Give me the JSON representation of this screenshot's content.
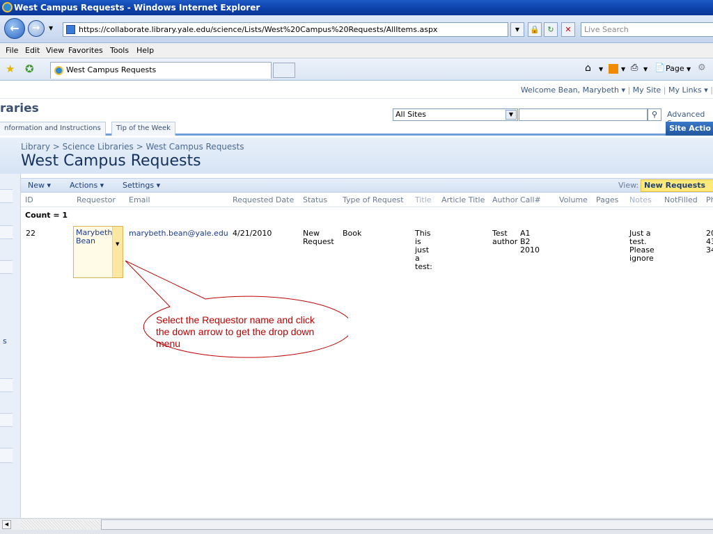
{
  "window": {
    "title": "West Campus Requests - Windows Internet Explorer"
  },
  "browser": {
    "url": "https://collaborate.library.yale.edu/science/Lists/West%20Campus%20Requests/AllItems.aspx",
    "search_placeholder": "Live Search",
    "menu": [
      "File",
      "Edit",
      "View",
      "Favorites",
      "Tools",
      "Help"
    ],
    "tab_title": "West Campus Requests",
    "page_tool": "Page"
  },
  "sharepoint": {
    "welcome": "Welcome Bean, Marybeth ▾",
    "my_site": "My Site",
    "my_links": "My Links ▾",
    "brand": "raries",
    "scope": "All Sites",
    "advanced_search": "Advanced Se",
    "nav_tabs": [
      "nformation and Instructions",
      "Tip of the Week"
    ],
    "site_actions": "Site Actio",
    "breadcrumb": "Library > Science Libraries > West Campus Requests",
    "page_title": "West Campus Requests"
  },
  "toolbar": {
    "new": "New ▾",
    "actions": "Actions ▾",
    "settings": "Settings ▾",
    "view_label": "View:",
    "view_value": "New Requests"
  },
  "list": {
    "columns": [
      "ID",
      "Requestor",
      "Email",
      "Requested Date",
      "Status",
      "Type of Request",
      "Title",
      "Article Title",
      "Author",
      "Call#",
      "Volume",
      "Pages",
      "Notes",
      "NotFilled",
      "Ph"
    ],
    "count": "Count = 1",
    "row": {
      "id": "22",
      "requestor": "Marybeth Bean",
      "email": "marybeth.bean@yale.edu",
      "date": "4/21/2010",
      "status": "New Request",
      "type": "Book",
      "title": "This is just a test:",
      "author": "Test author",
      "call": "A1 B2 2010",
      "notes": "Just a test. Please ignore",
      "phone": "20 43 34"
    }
  },
  "callout": {
    "text": "Select the Requestor name and click the down arrow to get the drop down menu"
  },
  "left_nav_char": "s",
  "colors": {
    "callout": "#c00000",
    "view_highlight": "#ffe97a",
    "link": "#1a3a94"
  }
}
